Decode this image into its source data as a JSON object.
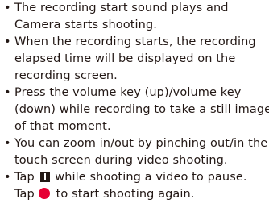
{
  "bullet_symbol": "•",
  "items": [
    {
      "lines": [
        "The recording start sound plays and",
        "Camera starts shooting."
      ]
    },
    {
      "lines": [
        "When the recording starts, the recording",
        "elapsed time will be displayed on the",
        "recording screen."
      ]
    },
    {
      "lines": [
        "Press the volume key (up)/volume key",
        "(down) while recording to take a still image",
        "of that moment."
      ]
    },
    {
      "lines": [
        "You can zoom in/out by pinching out/in the",
        "touch screen during video shooting."
      ]
    },
    {
      "line1_before": "Tap",
      "line1_after": "while shooting a video to pause.",
      "line2_before": "Tap",
      "line2_after": "to start shooting again.",
      "pause_icon": "pause-icon",
      "record_icon": "record-icon",
      "record_icon_color": "#e60033"
    }
  ]
}
